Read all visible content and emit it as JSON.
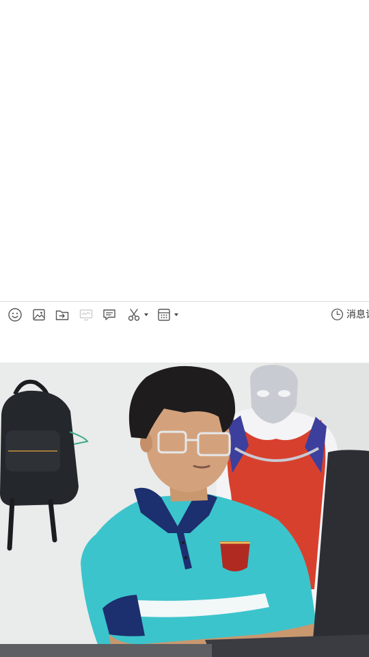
{
  "toolbar": {
    "tools": [
      {
        "name": "emoji-icon"
      },
      {
        "name": "image-icon"
      },
      {
        "name": "send-file-icon"
      },
      {
        "name": "screen-share-icon"
      },
      {
        "name": "comment-icon"
      },
      {
        "name": "screenshot-scissors-icon"
      },
      {
        "name": "more-apps-icon"
      }
    ],
    "history_label": "消息记录"
  },
  "input": {
    "value": "",
    "placeholder": ""
  },
  "colors": {
    "divider": "#dcdcdc",
    "icon": "#555555",
    "icon_disabled": "#c8c8c8",
    "wall": "#e9ecea",
    "shirt_teal": "#3cc4cc",
    "shirt_navy": "#1c2f6e"
  }
}
